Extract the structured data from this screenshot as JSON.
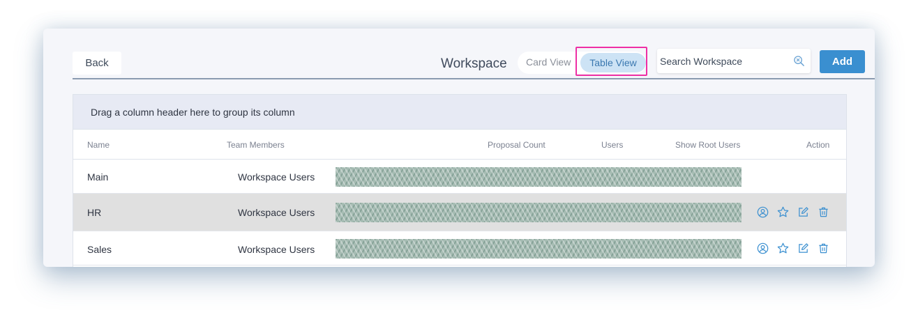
{
  "toolbar": {
    "back_label": "Back",
    "title": "Workspace",
    "view_toggle": {
      "card_label": "Card View",
      "table_label": "Table View",
      "active": "Table View"
    },
    "search": {
      "placeholder": "Search Workspace",
      "value": ""
    },
    "add_label": "Add"
  },
  "grid": {
    "group_panel_text": "Drag a column header here to group its column",
    "columns": {
      "name": "Name",
      "team_members": "Team Members",
      "proposal_count": "Proposal Count",
      "users": "Users",
      "show_root_users": "Show Root Users",
      "action": "Action"
    },
    "rows": [
      {
        "name": "Main",
        "team_members": "Workspace Users",
        "actions": []
      },
      {
        "name": "HR",
        "team_members": "Workspace Users",
        "selected": true,
        "actions": [
          "user-icon",
          "star-icon",
          "edit-icon",
          "trash-icon"
        ]
      },
      {
        "name": "Sales",
        "team_members": "Workspace Users",
        "actions": [
          "user-icon",
          "star-icon",
          "edit-icon",
          "trash-icon"
        ]
      }
    ]
  },
  "colors": {
    "accent": "#3a8fd0",
    "highlight": "#ee2fa5",
    "selected_row": "#e0e0e0",
    "active_toggle": "#cde3f5"
  }
}
